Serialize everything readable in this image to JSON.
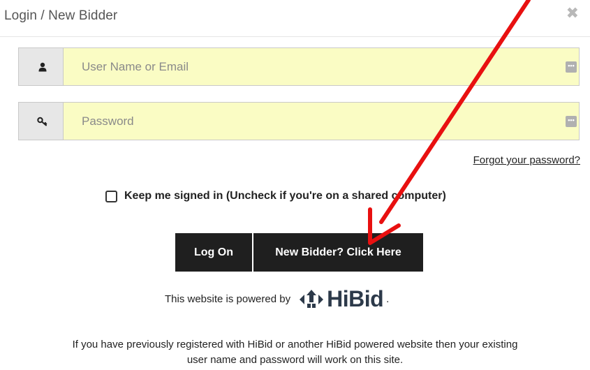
{
  "dialog": {
    "title": "Login / New Bidder",
    "close_glyph": "✖"
  },
  "login": {
    "username_placeholder": "User Name or Email",
    "password_placeholder": "Password",
    "forgot_link": "Forgot your password?",
    "remember_label": "Keep me signed in (Uncheck if you're on a shared computer)",
    "remember_checked": false
  },
  "buttons": {
    "logon_label": "Log On",
    "new_bidder_label": "New Bidder? Click Here"
  },
  "footer": {
    "powered_text": "This website is powered by",
    "brand_name": "HiBid",
    "powered_suffix": ".",
    "info_line1": "If you have previously registered with HiBid or another HiBid powered website then your existing",
    "info_line2": "user name and password will work on this site."
  },
  "icons": {
    "username": "user-icon",
    "password": "key-icon",
    "field_badge": "password-manager-icon",
    "annotation": "red-arrow"
  },
  "colors": {
    "field_bg": "#fafcc4",
    "button_bg": "#1f1f1f",
    "arrow": "#e81010",
    "brand": "#2d3a4a"
  }
}
